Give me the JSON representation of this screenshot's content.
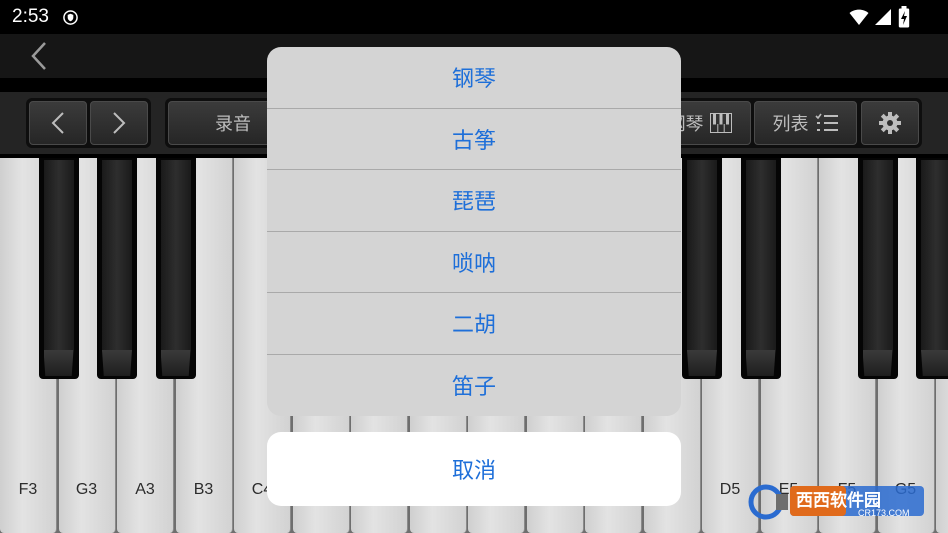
{
  "status_bar": {
    "time": "2:53",
    "icons": [
      "shield-icon",
      "wifi-icon",
      "signal-icon",
      "battery-charging-icon"
    ]
  },
  "nav": {
    "back_icon": "chevron-left-icon"
  },
  "toolbar": {
    "prev_icon": "chevron-left-icon",
    "next_icon": "chevron-right-icon",
    "record_label": "录音",
    "instrument_label_partial": "钢琴",
    "instrument_icon": "piano-keys-icon",
    "list_label": "列表",
    "list_icon": "list-icon",
    "settings_icon": "gear-icon"
  },
  "keyboard": {
    "white_keys": [
      {
        "label": "F3"
      },
      {
        "label": "G3"
      },
      {
        "label": "A3"
      },
      {
        "label": "B3"
      },
      {
        "label": "C4"
      },
      {
        "label": ""
      },
      {
        "label": ""
      },
      {
        "label": ""
      },
      {
        "label": ""
      },
      {
        "label": ""
      },
      {
        "label": ""
      },
      {
        "label": ""
      },
      {
        "label": "D5"
      },
      {
        "label": "E5"
      },
      {
        "label": "F5"
      },
      {
        "label": "G5"
      },
      {
        "label": ""
      }
    ]
  },
  "action_sheet": {
    "options": [
      {
        "label": "钢琴"
      },
      {
        "label": "古筝"
      },
      {
        "label": "琵琶"
      },
      {
        "label": "唢呐"
      },
      {
        "label": "二胡"
      },
      {
        "label": "笛子"
      }
    ],
    "cancel_label": "取消"
  },
  "watermark": {
    "text": "西西软件园",
    "subtext": "CR173.COM"
  },
  "colors": {
    "accent": "#1e6fd9",
    "sheet_bg": "#d4d4d4",
    "toolbar_bg": "#242424"
  }
}
